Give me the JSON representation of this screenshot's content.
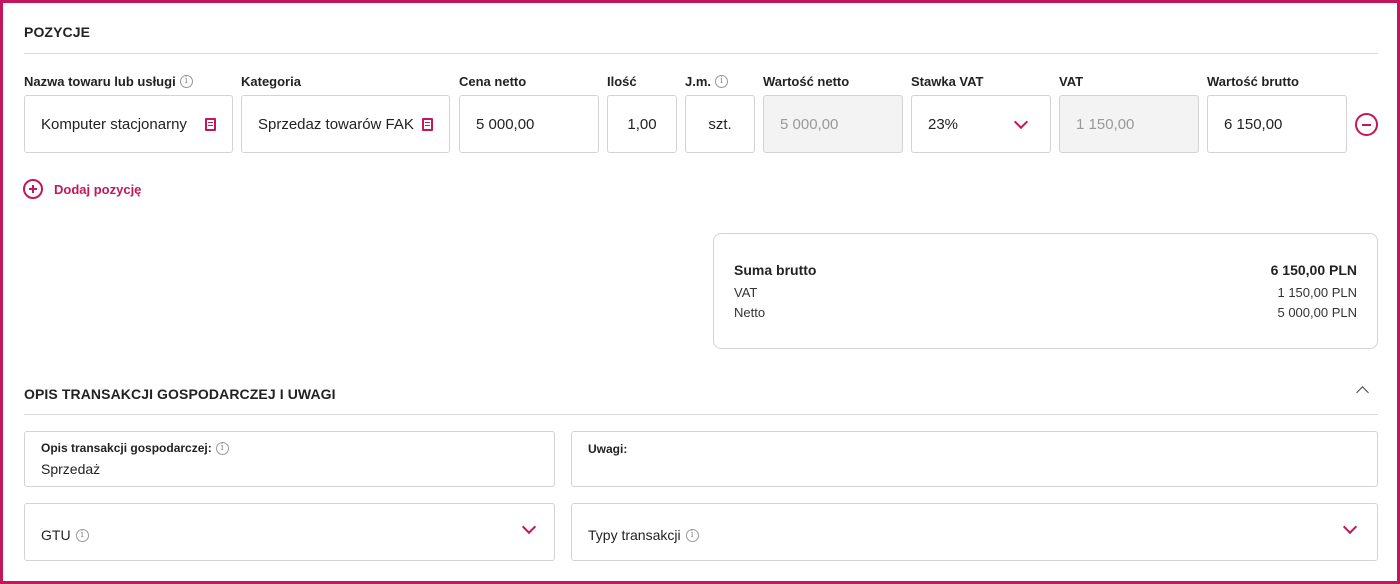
{
  "positions": {
    "title": "POZYCJE",
    "headers": {
      "name": "Nazwa towaru lub usługi",
      "category": "Kategoria",
      "net_price": "Cena netto",
      "quantity": "Ilość",
      "unit": "J.m.",
      "net_value": "Wartość netto",
      "vat_rate": "Stawka VAT",
      "vat": "VAT",
      "gross_value": "Wartość brutto"
    },
    "row": {
      "name": "Komputer stacjonarny",
      "category": "Sprzedaz towarów FAK",
      "net_price": "5 000,00",
      "quantity": "1,00",
      "unit": "szt.",
      "net_value": "5 000,00",
      "vat_rate": "23%",
      "vat": "1 150,00",
      "gross_value": "6 150,00"
    },
    "add_label": "Dodaj pozycję"
  },
  "summary": {
    "gross_label": "Suma brutto",
    "gross_value": "6 150,00 PLN",
    "vat_label": "VAT",
    "vat_value": "1 150,00 PLN",
    "net_label": "Netto",
    "net_value": "5 000,00 PLN"
  },
  "description": {
    "title": "OPIS TRANSAKCJI GOSPODARCZEJ I UWAGI",
    "opis_label": "Opis transakcji gospodarczej:",
    "opis_value": "Sprzedaż",
    "uwagi_label": "Uwagi:",
    "gtu_label": "GTU",
    "typy_label": "Typy transakcji"
  },
  "colors": {
    "accent": "#c2185b",
    "border": "#d3d3d3",
    "readonly_bg": "#f3f3f3"
  },
  "icons": [
    "info-icon",
    "book-icon",
    "chevron-down-icon",
    "chevron-up-icon",
    "minus-circle-icon",
    "plus-circle-icon"
  ]
}
